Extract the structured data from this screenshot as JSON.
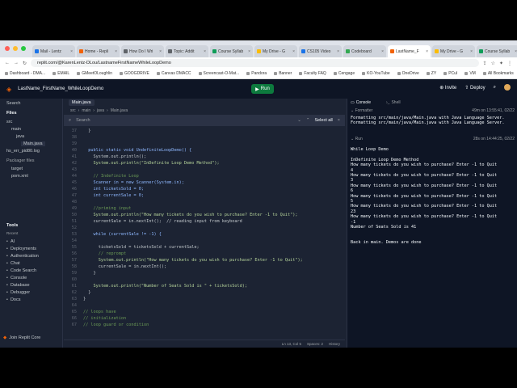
{
  "browser": {
    "tabs": [
      {
        "label": "Mail - Lentz",
        "color": "#1a73e8"
      },
      {
        "label": "Home - Repli",
        "color": "#f26207"
      },
      {
        "label": "How Do I Wri",
        "color": "#5f6368"
      },
      {
        "label": "Topic: Addit",
        "color": "#5f6368"
      },
      {
        "label": "Course Syllab",
        "color": "#0f9d58"
      },
      {
        "label": "My Drive - G",
        "color": "#fbbc04"
      },
      {
        "label": "CS105 Video",
        "color": "#1a73e8"
      },
      {
        "label": "Codeboard",
        "color": "#34a853"
      },
      {
        "label": "LastName_F",
        "color": "#f26207"
      },
      {
        "label": "My Drive - G",
        "color": "#fbbc04"
      },
      {
        "label": "Course Syllab",
        "color": "#0f9d58"
      }
    ],
    "url": "replit.com/@KarenLentz-DLou/LastnameFirstNameWhileLoopDemo",
    "bookmarks": [
      "Dashboard - DMA...",
      "EMAIL",
      "GMeetOLoughlin",
      "GOOGDRIVE",
      "Canvas DMACC",
      "Screencast-O-Mat...",
      "Pandora",
      "Banner",
      "Faculty FAQ",
      "Cengage",
      "KO-YouTube",
      "OneDrive",
      "ZY",
      "PCuI",
      "VM",
      "All Bookmarks"
    ]
  },
  "replit": {
    "project_title": "LastName_FirstName_WhileLoopDemo",
    "run_label": "Run",
    "invite_label": "Invite",
    "deploy_label": "Deploy"
  },
  "sidebar": {
    "search_label": "Search",
    "files_label": "Files",
    "tree": [
      {
        "label": "src",
        "indent": 0
      },
      {
        "label": "main",
        "indent": 1
      },
      {
        "label": "java",
        "indent": 2
      },
      {
        "label": "Main.java",
        "indent": 3
      },
      {
        "label": "hs_err_pid80.log",
        "indent": 0
      }
    ],
    "packager_label": "Packager files",
    "packager_items": [
      "target",
      "pom.xml"
    ],
    "tools_label": "Tools",
    "recent_label": "Recent",
    "tools": [
      "AI",
      "Deployments",
      "Authentication",
      "Chat",
      "Code Search",
      "Console",
      "Database",
      "Debugger",
      "Docs"
    ],
    "join_label": "Join Replit Core"
  },
  "editor": {
    "tab_label": "Main.java",
    "breadcrumb": [
      "src",
      "main",
      "java",
      "Main.java"
    ],
    "find_placeholder": "Search",
    "select_all_label": "Select all",
    "status": {
      "pos": "Ln 13, Col 5",
      "spaces": "Spaces: 2",
      "history": "History"
    },
    "lines": [
      {
        "n": "37",
        "t": "  }"
      },
      {
        "n": "38",
        "t": ""
      },
      {
        "n": "39",
        "t": ""
      },
      {
        "n": "40",
        "t": "  public static void UndefiniteLoopDemo() {"
      },
      {
        "n": "41",
        "t": "    System.out.println();"
      },
      {
        "n": "42",
        "t": "    System.out.println(\"InDefinite Loop Demo Method\");"
      },
      {
        "n": "43",
        "t": ""
      },
      {
        "n": "44",
        "t": "    // Indefinite Loop"
      },
      {
        "n": "45",
        "t": "    Scanner in = new Scanner(System.in);"
      },
      {
        "n": "46",
        "t": "    int ticketsSold = 0;"
      },
      {
        "n": "47",
        "t": "    int currentSale = 0;"
      },
      {
        "n": "48",
        "t": ""
      },
      {
        "n": "49",
        "t": "    //priming input"
      },
      {
        "n": "50",
        "t": "    System.out.println(\"How many tickets do you wish to purchase? Enter -1 to Quit\");"
      },
      {
        "n": "51",
        "t": "    currentSale = in.nextInt();  // reading input from keyboard"
      },
      {
        "n": "52",
        "t": ""
      },
      {
        "n": "53",
        "t": "    while (currentSale != -1) {"
      },
      {
        "n": "54",
        "t": ""
      },
      {
        "n": "55",
        "t": "      ticketsSold = ticketsSold + currentSale;"
      },
      {
        "n": "56",
        "t": "      // reprompt"
      },
      {
        "n": "57",
        "t": "      System.out.println(\"How many tickets do you wish to purchase? Enter -1 to Quit\");"
      },
      {
        "n": "58",
        "t": "      currentSale = in.nextInt();"
      },
      {
        "n": "59",
        "t": "    }"
      },
      {
        "n": "60",
        "t": ""
      },
      {
        "n": "61",
        "t": "    System.out.println(\"Number of Seats Sold is \" + ticketsSold);"
      },
      {
        "n": "62",
        "t": "  }"
      },
      {
        "n": "63",
        "t": "}"
      },
      {
        "n": "64",
        "t": ""
      },
      {
        "n": "65",
        "t": "// loops have"
      },
      {
        "n": "66",
        "t": "// initialization"
      },
      {
        "n": "67",
        "t": "// loop guard or condition"
      }
    ]
  },
  "console": {
    "tab_console": "Console",
    "tab_shell": "Shell",
    "formatter_label": "Formatter",
    "formatter_time": "49m on 13:55:41, 02/22",
    "formatter_output": "Formatting src/main/java/Main.java with Java Language Server.\nFormatting src/main/java/Main.java with Java Language Server.",
    "run_label": "Run",
    "run_time": "28s on 14:44:25, 02/22",
    "run_output": "While Loop Demo\n\nInDefinite Loop Demo Method\nHow many tickets do you wish to purchase? Enter -1 to Quit\n4\nHow many tickets do you wish to purchase? Enter -1 to Quit\n3\nHow many tickets do you wish to purchase? Enter -1 to Quit\n6\nHow many tickets do you wish to purchase? Enter -1 to Quit\n5\nHow many tickets do you wish to purchase? Enter -1 to Quit\n23\nHow many tickets do you wish to purchase? Enter -1 to Quit\n-1\nNumber of Seats Sold is 41\n\n\nBack in main. Demos are done"
  }
}
